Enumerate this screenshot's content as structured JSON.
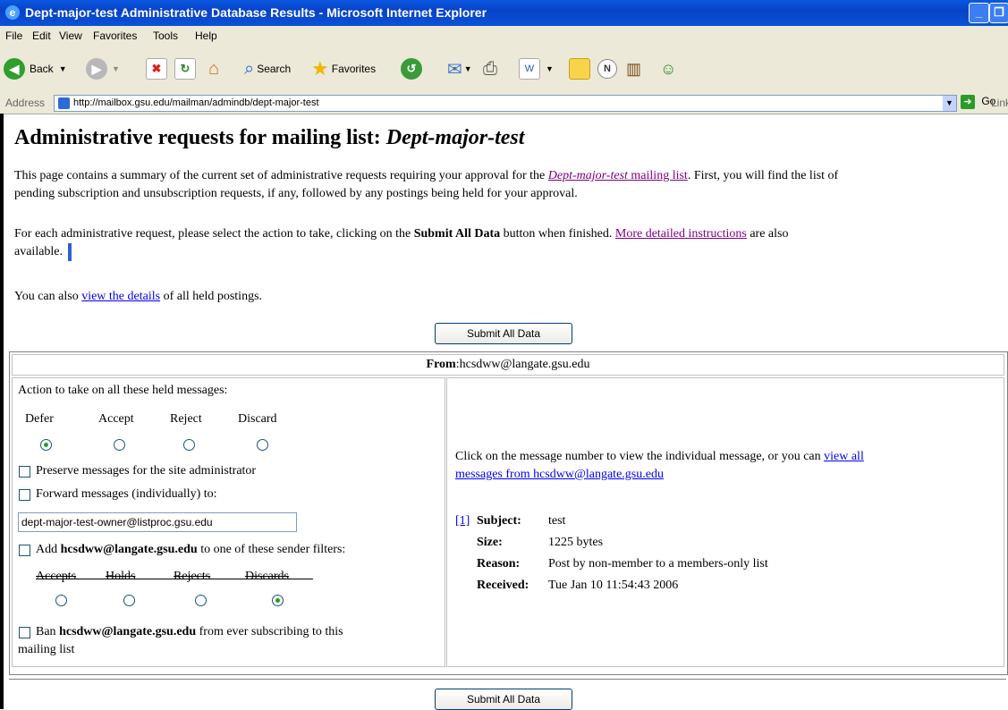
{
  "window": {
    "title": "Dept-major-test Administrative Database Results - Microsoft Internet Explorer"
  },
  "menu": [
    "File",
    "Edit",
    "View",
    "Favorites",
    "Tools",
    "Help"
  ],
  "toolbar": {
    "back": "Back",
    "search": "Search",
    "favorites": "Favorites"
  },
  "address": {
    "label": "Address",
    "url": "http://mailbox.gsu.edu/mailman/admindb/dept-major-test",
    "go": "Go",
    "links": "Links"
  },
  "page": {
    "heading_prefix": "Administrative requests for mailing list: ",
    "heading_list": "Dept-major-test",
    "p1_a": "This page contains a summary of the current set of administrative requests requiring your approval for the ",
    "p1_link": "Dept-major-test",
    "p1_link_suffix": " mailing list",
    "p1_b": ". First, you will find the list of",
    "p1_c": "pending subscription and unsubscription requests, if any, followed by any postings being held for your approval.",
    "p2_a": "For each administrative request, please select the action to take, clicking on the ",
    "p2_bold": "Submit All Data",
    "p2_b": " button when finished. ",
    "p2_link": "More detailed instructions",
    "p2_c": " are also",
    "p2_d": "available.",
    "p3_a": "You can also ",
    "p3_link": "view the details",
    "p3_b": " of all held postings.",
    "submit": "Submit All Data"
  },
  "held": {
    "from_label": "From",
    "from_email": "hcsdww@langate.gsu.edu",
    "action_title": "Action to take on all these held messages:",
    "actions": [
      "Defer",
      "Accept",
      "Reject",
      "Discard"
    ],
    "preserve": "Preserve messages for the site administrator",
    "forward": "Forward messages (individually) to:",
    "forward_to": "dept-major-test-owner@listproc.gsu.edu",
    "add_a": "Add ",
    "add_email": "hcsdww@langate.gsu.edu",
    "add_b": " to one of these sender filters:",
    "filters": [
      "Accepts",
      "Holds",
      "Rejects",
      "Discards"
    ],
    "ban_a": "Ban ",
    "ban_email": "hcsdww@langate.gsu.edu",
    "ban_b": " from ever subscribing to this",
    "ban_c": "mailing list",
    "click_text": "Click on the message number to view the individual message, or you can ",
    "view_all_1": "view all",
    "view_all_2": "messages from hcsdww@langate.gsu.edu",
    "msg_number": "[1]",
    "subject_label": "Subject:",
    "subject": "test",
    "size_label": "Size:",
    "size": "1225 bytes",
    "reason_label": "Reason:",
    "reason": "Post by non-member to a members-only list",
    "received_label": "Received:",
    "received": "Tue Jan 10 11:54:43 2006"
  }
}
